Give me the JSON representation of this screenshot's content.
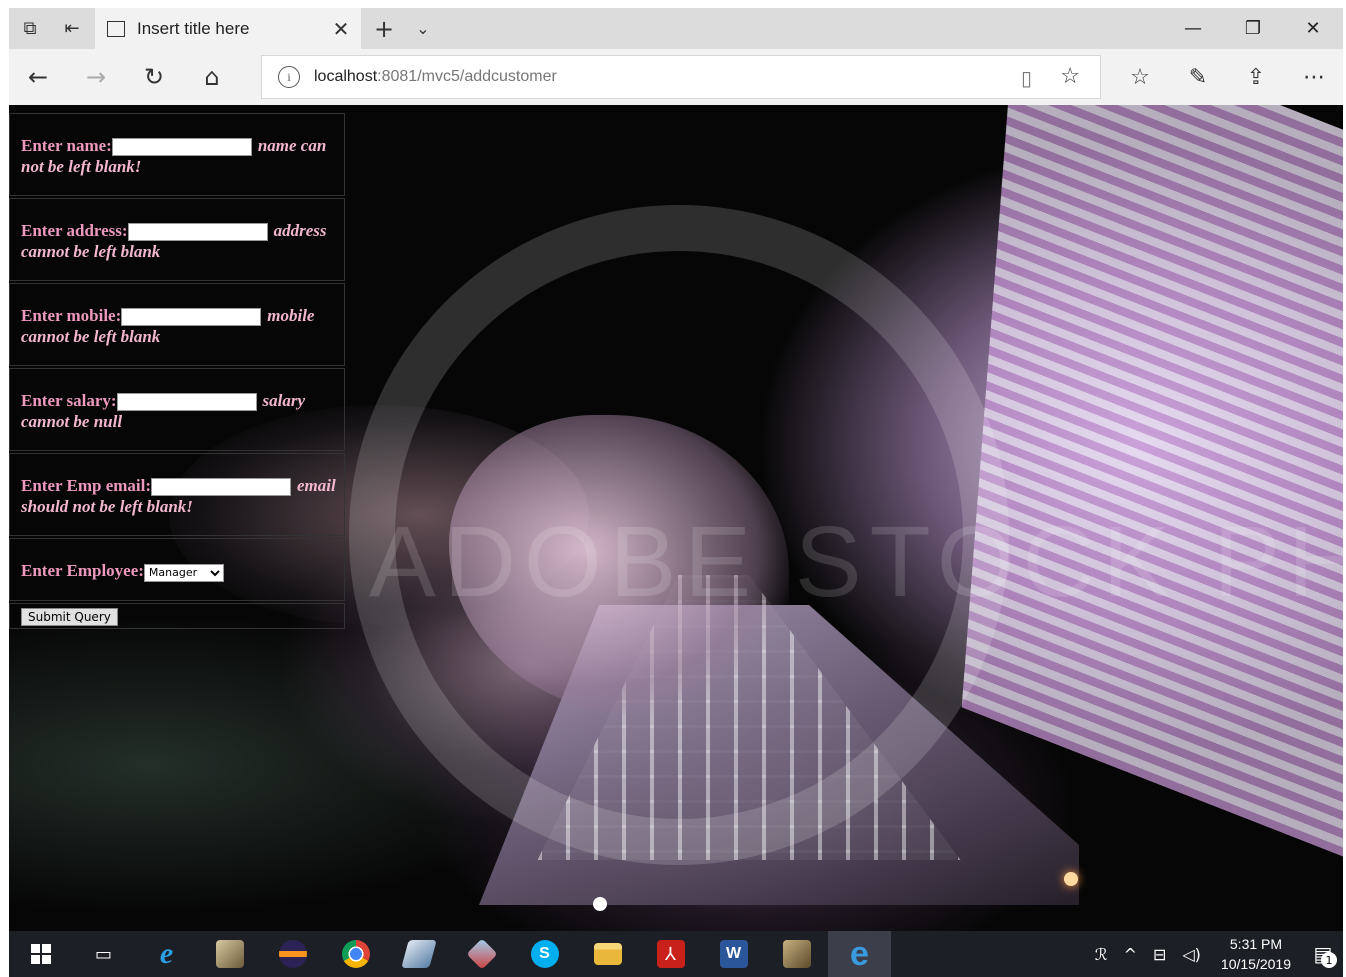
{
  "browser": {
    "tab_title": "Insert title here",
    "url_host": "localhost",
    "url_rest": ":8081/mvc5/addcustomer",
    "accent": "#0078d7"
  },
  "form": {
    "name_label": "Enter name:",
    "name_error": "name can not be left blank!",
    "address_label": "Enter address:",
    "address_error": "address cannot be left blank",
    "mobile_label": "Enter mobile:",
    "mobile_error": "mobile cannot be left blank",
    "salary_label": "Enter salary:",
    "salary_error": "salary cannot be null",
    "email_label": "Enter Emp email:",
    "email_error": "email should not be left blank!",
    "employee_label": "Enter Employee:",
    "employee_selected": "Manager",
    "submit_label": "Submit Query",
    "label_color": "#ec98bf"
  },
  "background": {
    "watermark": "ADOBE STOCK PHOTOS"
  },
  "taskbar": {
    "time": "5:31 PM",
    "date": "10/15/2019",
    "notification_count": "1",
    "apps": [
      "task-view",
      "internet-explorer",
      "app-2",
      "eclipse",
      "chrome",
      "app-5",
      "git",
      "skype",
      "file-explorer",
      "acrobat",
      "word",
      "app-11",
      "edge"
    ]
  }
}
